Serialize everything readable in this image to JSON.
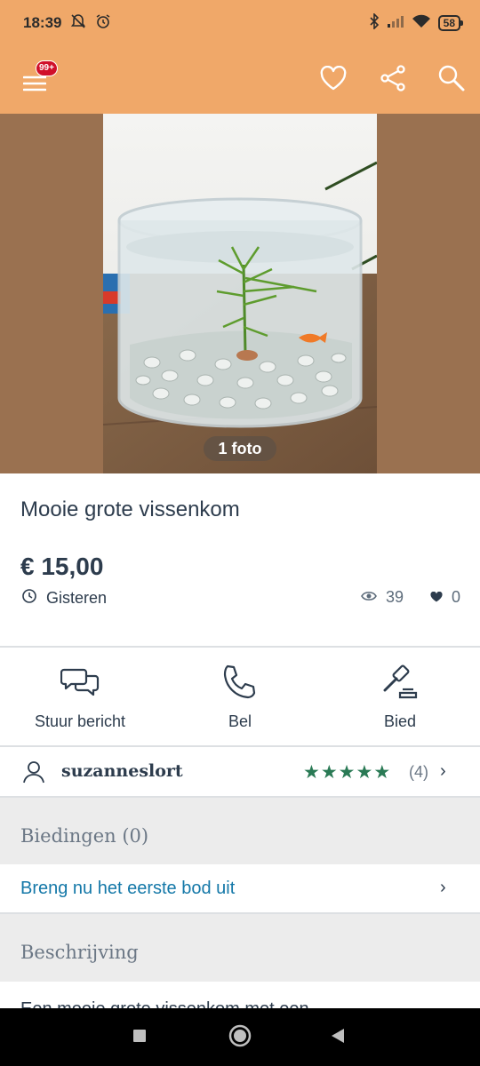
{
  "status_bar": {
    "time": "18:39",
    "battery": "58",
    "icons": [
      "bell-muted-icon",
      "alarm-icon",
      "bluetooth-icon",
      "signal-icon",
      "wifi-icon",
      "battery-icon"
    ]
  },
  "app_bar": {
    "menu_badge": "99+",
    "icons": [
      "menu-icon",
      "heart-icon",
      "share-icon",
      "search-icon"
    ]
  },
  "listing": {
    "photo_count": "1 foto",
    "title": "Mooie grote vissenkom",
    "price": "€ 15,00",
    "date": "Gisteren",
    "views": "39",
    "favorites": "0"
  },
  "actions": {
    "message_label": "Stuur bericht",
    "call_label": "Bel",
    "bid_label": "Bied"
  },
  "seller": {
    "name": "suzanneslort",
    "rating": 5,
    "review_count": "(4)"
  },
  "bids": {
    "title": "Biedingen (0)",
    "cta": "Breng nu het eerste bod uit"
  },
  "description": {
    "title": "Beschrijving",
    "text_preview": "Een mooie grote vissenkom met een"
  },
  "colors": {
    "app_bar": "#f0a869",
    "photo_bg": "#9a7150",
    "accent_link": "#1478a8",
    "stars": "#2a7a55",
    "badge": "#d0102a"
  }
}
